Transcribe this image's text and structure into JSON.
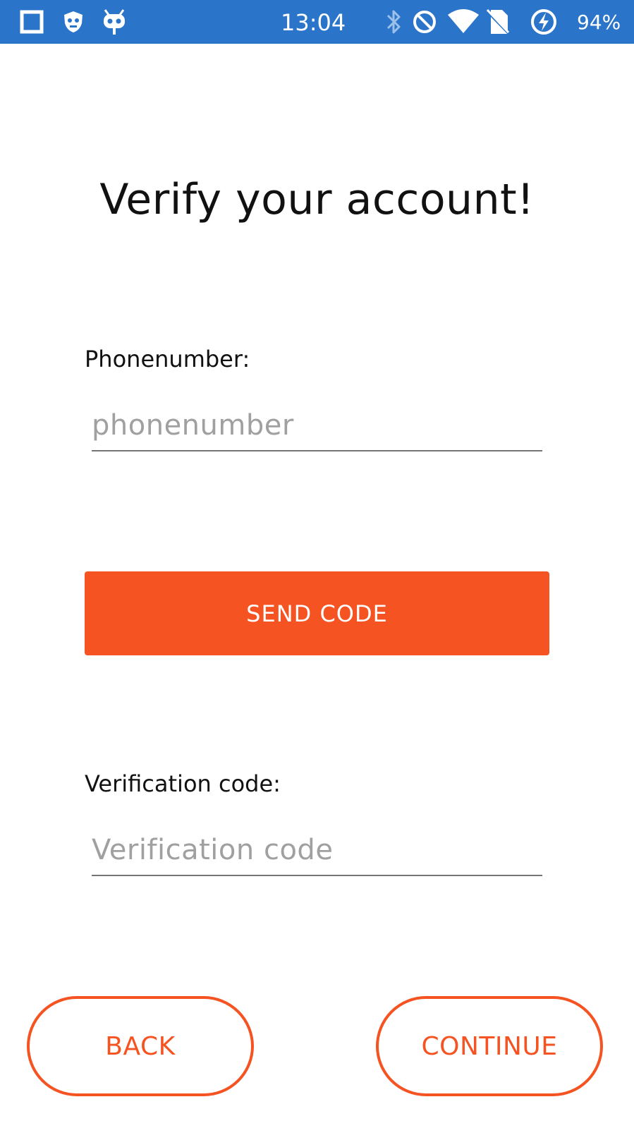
{
  "status_bar": {
    "time": "13:04",
    "battery_percent": "94%",
    "background_color": "#2a74c9",
    "icons_left": [
      "square-notification-icon",
      "shield-mascot-icon",
      "cyanogen-robot-icon"
    ],
    "icons_right": [
      "bluetooth-icon",
      "do-not-disturb-icon",
      "wifi-icon",
      "no-sim-icon",
      "battery-charging-icon"
    ]
  },
  "page": {
    "title": "Verify your account!"
  },
  "phone": {
    "label": "Phonenumber:",
    "placeholder": "phonenumber",
    "value": ""
  },
  "send_code": {
    "label": "SEND CODE",
    "color": "#f55321"
  },
  "verification": {
    "label": "Verification code:",
    "placeholder": "Verification code",
    "value": ""
  },
  "footer": {
    "back_label": "BACK",
    "continue_label": "CONTINUE",
    "accent_color": "#f55321"
  }
}
